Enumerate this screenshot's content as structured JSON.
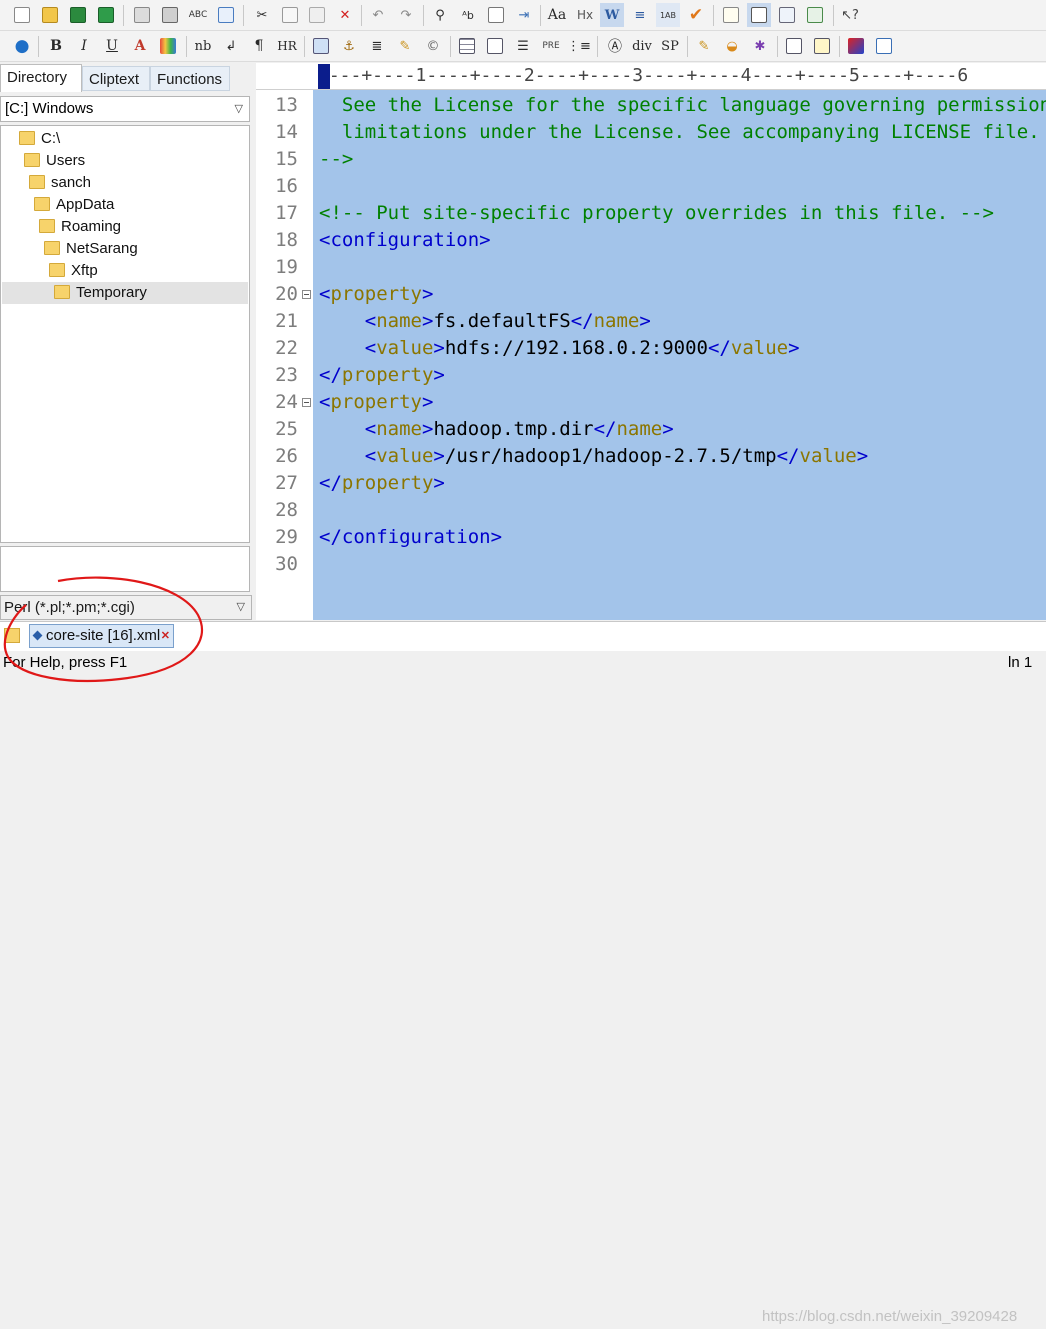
{
  "left_tabs": [
    "Directory",
    "Cliptext",
    "Functions"
  ],
  "drive": "[C:] Windows",
  "tree": [
    "C:\\",
    "Users",
    "sanch",
    "AppData",
    "Roaming",
    "NetSarang",
    "Xftp",
    "Temporary"
  ],
  "filter": "Perl (*.pl;*.pm;*.cgi)",
  "ruler": "----+----1----+----2----+----3----+----4----+----5----+----6",
  "lines": [
    {
      "n": "13",
      "parts": [
        {
          "c": "cmt",
          "t": "  See the License for the specific language governing permissions and"
        }
      ]
    },
    {
      "n": "14",
      "parts": [
        {
          "c": "cmt",
          "t": "  limitations under the License. See accompanying LICENSE file."
        }
      ]
    },
    {
      "n": "15",
      "parts": [
        {
          "c": "cmt",
          "t": "-->"
        }
      ]
    },
    {
      "n": "16",
      "parts": []
    },
    {
      "n": "17",
      "parts": [
        {
          "c": "cmt",
          "t": "<!-- Put site-specific property overrides in this file. -->"
        }
      ]
    },
    {
      "n": "18",
      "parts": [
        {
          "c": "tag",
          "t": "<configuration>"
        }
      ]
    },
    {
      "n": "19",
      "parts": []
    },
    {
      "n": "20",
      "fold": true,
      "parts": [
        {
          "c": "tag",
          "t": "<"
        },
        {
          "c": "tagname",
          "t": "property"
        },
        {
          "c": "tag",
          "t": ">"
        }
      ]
    },
    {
      "n": "21",
      "parts": [
        {
          "c": "txtv",
          "t": "    "
        },
        {
          "c": "tag",
          "t": "<"
        },
        {
          "c": "tagname",
          "t": "name"
        },
        {
          "c": "tag",
          "t": ">"
        },
        {
          "c": "txtv",
          "t": "fs.defaultFS"
        },
        {
          "c": "tag",
          "t": "</"
        },
        {
          "c": "tagname",
          "t": "name"
        },
        {
          "c": "tag",
          "t": ">"
        }
      ]
    },
    {
      "n": "22",
      "parts": [
        {
          "c": "txtv",
          "t": "    "
        },
        {
          "c": "tag",
          "t": "<"
        },
        {
          "c": "tagname",
          "t": "value"
        },
        {
          "c": "tag",
          "t": ">"
        },
        {
          "c": "txtv",
          "t": "hdfs://192.168.0.2:9000"
        },
        {
          "c": "tag",
          "t": "</"
        },
        {
          "c": "tagname",
          "t": "value"
        },
        {
          "c": "tag",
          "t": ">"
        }
      ]
    },
    {
      "n": "23",
      "parts": [
        {
          "c": "tag",
          "t": "</"
        },
        {
          "c": "tagname",
          "t": "property"
        },
        {
          "c": "tag",
          "t": ">"
        }
      ]
    },
    {
      "n": "24",
      "fold": true,
      "parts": [
        {
          "c": "tag",
          "t": "<"
        },
        {
          "c": "tagname",
          "t": "property"
        },
        {
          "c": "tag",
          "t": ">"
        }
      ]
    },
    {
      "n": "25",
      "parts": [
        {
          "c": "txtv",
          "t": "    "
        },
        {
          "c": "tag",
          "t": "<"
        },
        {
          "c": "tagname",
          "t": "name"
        },
        {
          "c": "tag",
          "t": ">"
        },
        {
          "c": "txtv",
          "t": "hadoop.tmp.dir"
        },
        {
          "c": "tag",
          "t": "</"
        },
        {
          "c": "tagname",
          "t": "name"
        },
        {
          "c": "tag",
          "t": ">"
        }
      ]
    },
    {
      "n": "26",
      "parts": [
        {
          "c": "txtv",
          "t": "    "
        },
        {
          "c": "tag",
          "t": "<"
        },
        {
          "c": "tagname",
          "t": "value"
        },
        {
          "c": "tag",
          "t": ">"
        },
        {
          "c": "txtv",
          "t": "/usr/hadoop1/hadoop-2.7.5/tmp"
        },
        {
          "c": "tag",
          "t": "</"
        },
        {
          "c": "tagname",
          "t": "value"
        },
        {
          "c": "tag",
          "t": ">"
        }
      ]
    },
    {
      "n": "27",
      "parts": [
        {
          "c": "tag",
          "t": "</"
        },
        {
          "c": "tagname",
          "t": "property"
        },
        {
          "c": "tag",
          "t": ">"
        }
      ]
    },
    {
      "n": "28",
      "parts": []
    },
    {
      "n": "29",
      "parts": [
        {
          "c": "tag",
          "t": "</configuration>"
        }
      ]
    },
    {
      "n": "30",
      "parts": []
    }
  ],
  "file_tab": "core-site [16].xml",
  "status_text": "For Help, press F1",
  "status_position": "ln 1",
  "watermark": "https://blog.csdn.net/weixin_39209428",
  "toolbar2_text": {
    "nb": "nb",
    "hr": "HR",
    "pre": "PRE",
    "div": "div",
    "sp": "SP"
  }
}
